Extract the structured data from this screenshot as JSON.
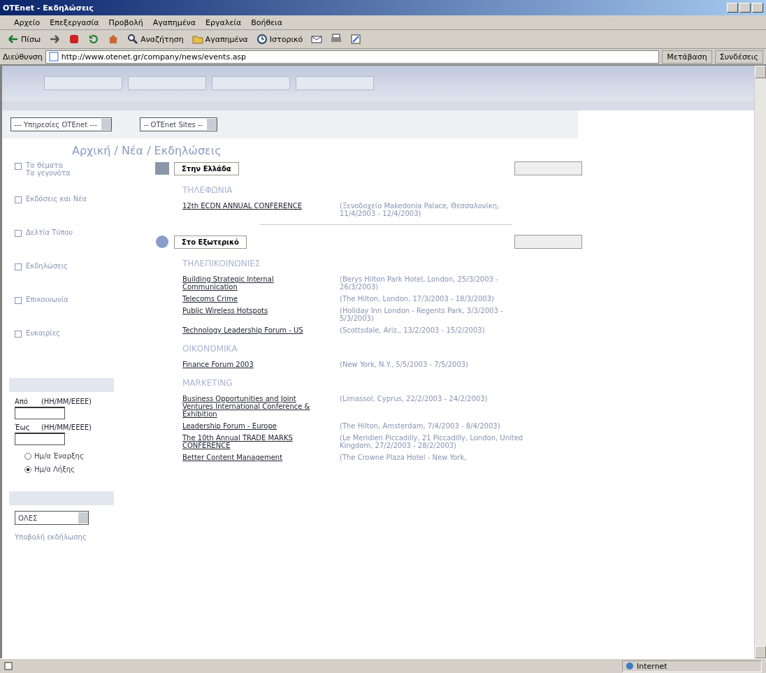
{
  "window": {
    "title": "OTEnet - Εκδηλώσεις"
  },
  "menu": [
    "Αρχείο",
    "Επεξεργασία",
    "Προβολή",
    "Αγαπημένα",
    "Εργαλεία",
    "Βοήθεια"
  ],
  "toolbar": [
    {
      "kind": "back",
      "label": "Πίσω"
    },
    {
      "kind": "forward"
    },
    {
      "kind": "stop"
    },
    {
      "kind": "refresh"
    },
    {
      "kind": "home"
    },
    {
      "kind": "search",
      "label": "Αναζήτηση"
    },
    {
      "kind": "favorites",
      "label": "Αγαπημένα"
    },
    {
      "kind": "history",
      "label": "Ιστορικό"
    },
    {
      "kind": "mail"
    },
    {
      "kind": "print"
    },
    {
      "kind": "edit"
    }
  ],
  "address_bar": {
    "label": "Διεύθυνση",
    "url": "http://www.otenet.gr/company/news/events.asp",
    "go": "Μετάβαση",
    "links": "Συνδέσεις"
  },
  "site_selects": [
    "--- Υπηρεσίες OTEnet ---",
    "-- OTEnet Sites --"
  ],
  "breadcrumb": "Αρχική / Νέα / Εκδηλώσεις",
  "sidebar": {
    "items": [
      "Τα θέματα\nΤα γεγονότα",
      "Εκδόσεις και Νέα",
      "Δελτία Τύπου",
      "Εκδηλώσεις",
      "Επικοινωνία",
      "Ευκαιρίες"
    ],
    "from_label": "Από",
    "from_format": "(ΗΗ/ΜΜ/ΕΕΕΕ)",
    "to_label": "Έως",
    "to_format": "(ΗΗ/ΜΜ/ΕΕΕΕ)",
    "radios": [
      {
        "label": "Ημ/α Έναρξης",
        "selected": false
      },
      {
        "label": "Ημ/α Λήξης",
        "selected": true
      }
    ],
    "category_select": "ΟΛΕΣ",
    "submit_link": "Υποβολή εκδήλωσης"
  },
  "sections": [
    {
      "kind": "greece",
      "tab": "Στην Ελλάδα",
      "groups": [
        {
          "heading": "ΤΗΛΕΦΩΝΙΑ",
          "events": [
            {
              "title": "12th ECDN ANNUAL CONFERENCE",
              "place": "(Ξενοδοχείο Makedonia Palace, Θεσσαλονίκη, 11/4/2003 - 12/4/2003)"
            }
          ]
        }
      ]
    },
    {
      "kind": "abroad",
      "tab": "Στο Εξωτερικό",
      "groups": [
        {
          "heading": "ΤΗΛΕΠΙΚΟΙΝΩΝΙΕΣ",
          "events": [
            {
              "title": "Building Strategic Internal Communication",
              "place": "(Berys Hilton Park Hotel, London, 25/3/2003 - 26/3/2003)"
            },
            {
              "title": "Telecoms Crime",
              "place": "(The Hilton, London, 17/3/2003 - 18/3/2003)"
            },
            {
              "title": "Public Wireless Hotspots",
              "place": "(Holiday Inn London - Regents Park, 3/3/2003 - 5/3/2003)"
            },
            {
              "title": "Technology Leadership Forum - US",
              "place": "(Scottsdale, Ariz., 13/2/2003 - 15/2/2003)"
            }
          ]
        },
        {
          "heading": "ΟΙΚΟΝΟΜΙΚΑ",
          "events": [
            {
              "title": "Finance Forum 2003",
              "place": "(New York, N.Y., 5/5/2003 - 7/5/2003)"
            }
          ]
        },
        {
          "heading": "MARKETING",
          "events": [
            {
              "title": "Business Opportunities and Joint Ventures International Conference & Exhibition",
              "place": "(Limassol, Cyprus, 22/2/2003 - 24/2/2003)"
            },
            {
              "title": "Leadership Forum - Europe",
              "place": "(The Hilton, Amsterdam, 7/4/2003 - 8/4/2003)"
            },
            {
              "title": "The 10th Annual TRADE MARKS CONFERENCE",
              "place": "(Le Meridien Piccadilly, 21 Piccadilly, London, United Kingdom, 27/2/2003 - 28/2/2003)"
            },
            {
              "title": "Better Content Management",
              "place": "(The Crowne Plaza Hotel - New York,"
            }
          ]
        }
      ]
    }
  ],
  "status_bar": {
    "zone": "Internet"
  }
}
